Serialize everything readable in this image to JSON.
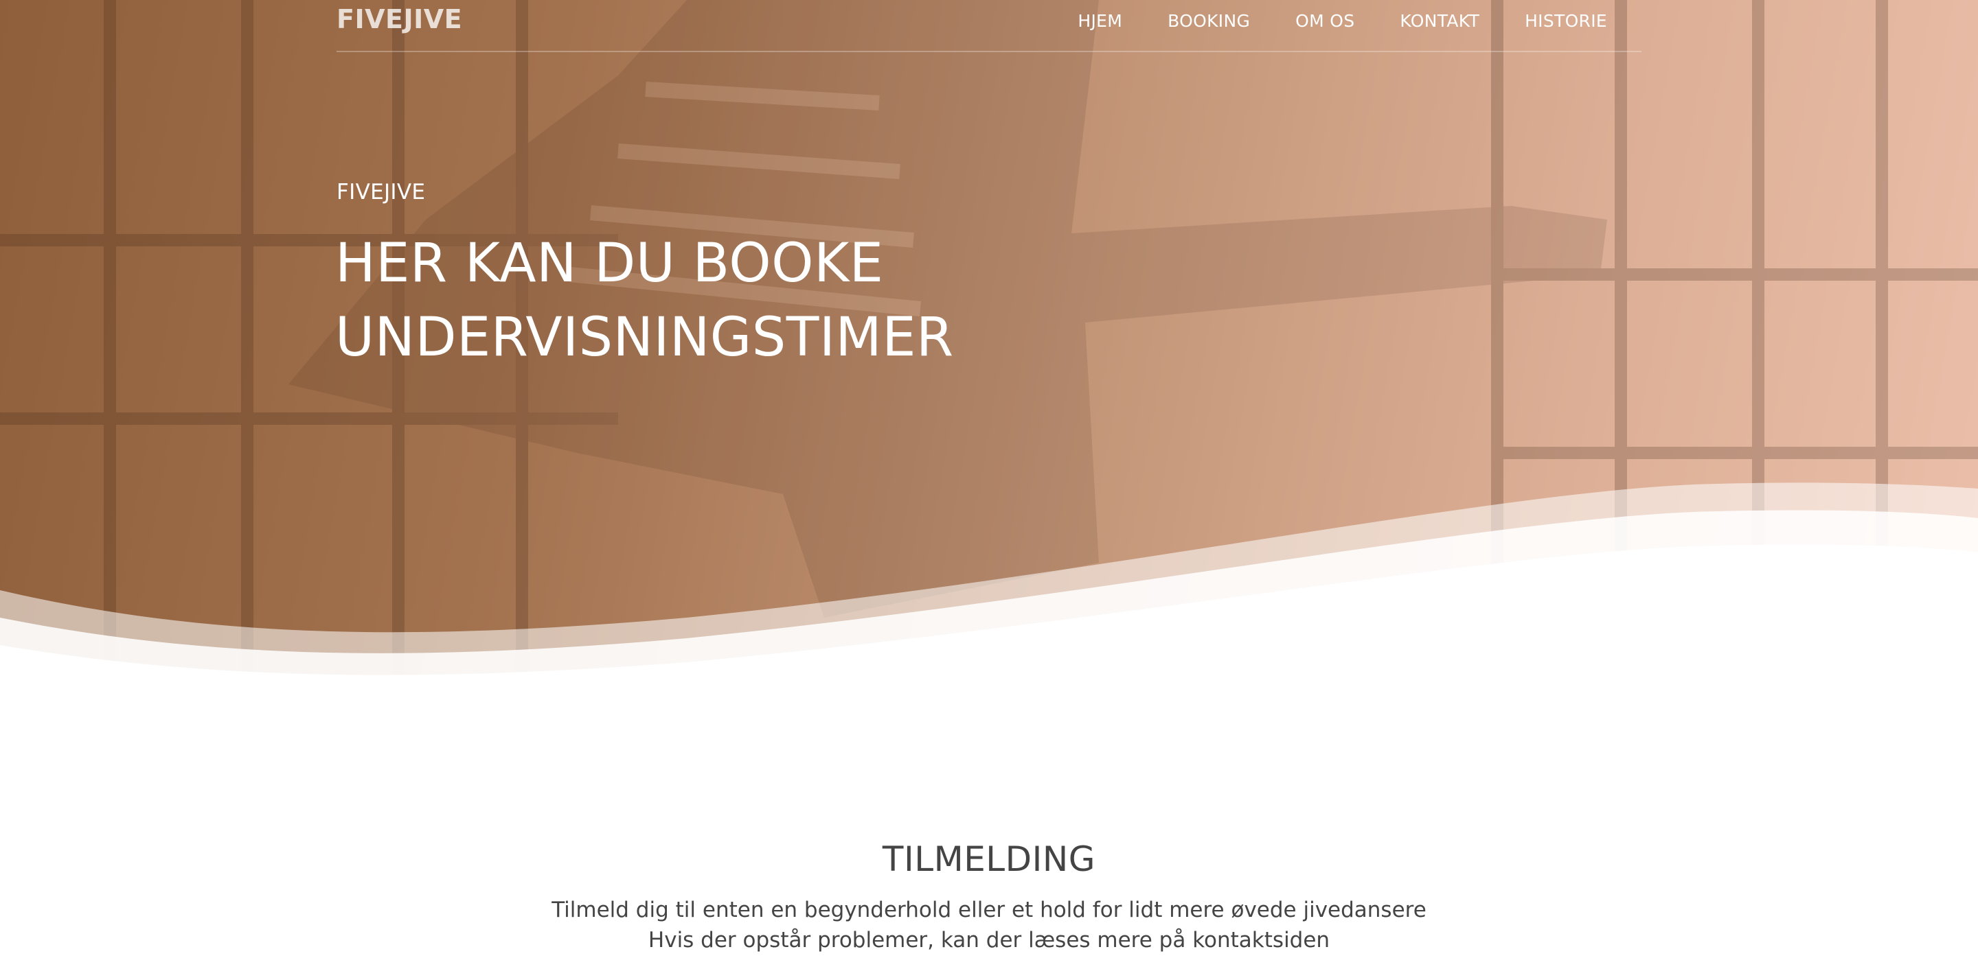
{
  "header": {
    "logo": "FIVEJIVE",
    "nav": [
      {
        "label": "HJEM"
      },
      {
        "label": "BOOKING"
      },
      {
        "label": "OM OS"
      },
      {
        "label": "KONTAKT"
      },
      {
        "label": "HISTORIE"
      }
    ]
  },
  "hero": {
    "eyebrow": "FIVEJIVE",
    "title_line1": "HER KAN DU BOOKE",
    "title_line2": "UNDERVISNINGSTIMER"
  },
  "signup": {
    "title": "TILMELDING",
    "line1": "Tilmeld dig til enten en begynderhold eller et hold for lidt mere øvede jivedansere",
    "line2": "Hvis der opstår problemer, kan der læses mere på kontaktsiden"
  },
  "colors": {
    "hero_start": "#8f5f3b",
    "hero_end": "#ebbfaa",
    "text_dark": "#444444",
    "text_light": "#ffffff"
  }
}
